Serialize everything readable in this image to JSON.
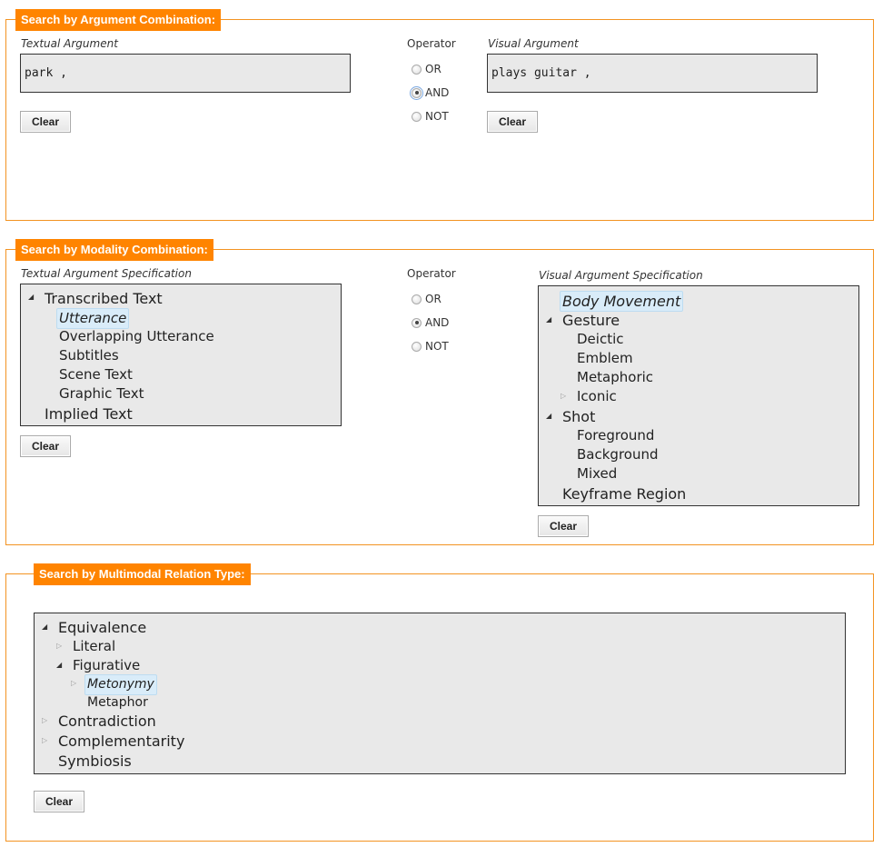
{
  "argument_section": {
    "legend": "Search by Argument Combination:",
    "textual": {
      "label": "Textual Argument",
      "value": "park ,"
    },
    "operator": {
      "label": "Operator",
      "options": [
        "OR",
        "AND",
        "NOT"
      ],
      "selected": "AND"
    },
    "visual": {
      "label": "Visual Argument",
      "value": "plays guitar ,"
    },
    "clear_label": "Clear"
  },
  "modality_section": {
    "legend": "Search by Modality Combination:",
    "textual": {
      "label": "Textual Argument Specification",
      "tree": [
        {
          "label": "Transcribed Text",
          "toggle": "expanded"
        },
        {
          "label": "Utterance",
          "selected": true
        },
        {
          "label": "Overlapping Utterance"
        },
        {
          "label": "Subtitles"
        },
        {
          "label": "Scene Text"
        },
        {
          "label": "Graphic Text"
        },
        {
          "label": "Implied Text"
        }
      ]
    },
    "operator": {
      "label": "Operator",
      "options": [
        "OR",
        "AND",
        "NOT"
      ],
      "selected": "AND"
    },
    "visual": {
      "label": "Visual Argument Specification",
      "tree": [
        {
          "label": "Body Movement",
          "selected": true
        },
        {
          "label": "Gesture",
          "toggle": "expanded"
        },
        {
          "label": "Deictic"
        },
        {
          "label": "Emblem"
        },
        {
          "label": "Metaphoric"
        },
        {
          "label": "Iconic",
          "toggle": "collapsed"
        },
        {
          "label": "Shot",
          "toggle": "expanded"
        },
        {
          "label": "Foreground"
        },
        {
          "label": "Background"
        },
        {
          "label": "Mixed"
        },
        {
          "label": "Keyframe Region"
        }
      ]
    },
    "clear_label": "Clear"
  },
  "relation_section": {
    "legend": "Search by Multimodal Relation Type:",
    "tree": [
      {
        "label": "Equivalence",
        "toggle": "expanded"
      },
      {
        "label": "Literal",
        "toggle": "collapsed"
      },
      {
        "label": "Figurative",
        "toggle": "expanded"
      },
      {
        "label": "Metonymy",
        "toggle": "collapsed",
        "selected": true
      },
      {
        "label": "Metaphor"
      },
      {
        "label": "Contradiction",
        "toggle": "collapsed"
      },
      {
        "label": "Complementarity",
        "toggle": "collapsed"
      },
      {
        "label": "Symbiosis"
      }
    ],
    "clear_label": "Clear"
  },
  "icons": {
    "expanded": "◢",
    "collapsed": "▷"
  }
}
